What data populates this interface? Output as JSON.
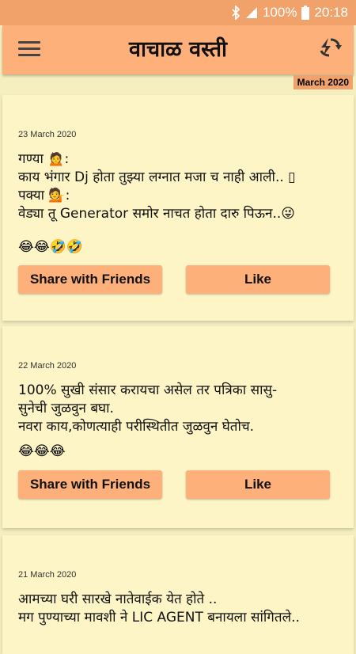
{
  "status_bar": {
    "battery": "100%",
    "time": "20:18"
  },
  "app_bar": {
    "title": "वाचाळ वस्ती"
  },
  "month_tag": "March 2020",
  "posts": [
    {
      "date": "23 March 2020",
      "text": "गण्या 🙍:\nकाय भंगार Dj होता तुझ्या लग्नात मजा च नाही आली.. ▯\nपक्या 💁:\nवेड्या तू Generator समोर नाचत होता दारु पिऊन..😜",
      "emojis": "😂😂🤣🤣",
      "share_label": "Share with Friends",
      "like_label": "Like"
    },
    {
      "date": "22 March 2020",
      "text": "100% सुखी संसार करायचा असेल तर पत्रिका सासु-\nसुनेची जुळवुन बघा.\nनवरा काय,कोणत्याही परीस्थितीत जुळवुन घेतोच.",
      "emojis": "😂😂😂",
      "share_label": "Share with Friends",
      "like_label": "Like"
    },
    {
      "date": "21 March 2020",
      "text": "आमच्या घरी सारखे नातेवाईक येत होते ..\nमग पुण्याच्या मावशी ने LIC AGENT बनायला सांगितले.."
    }
  ]
}
